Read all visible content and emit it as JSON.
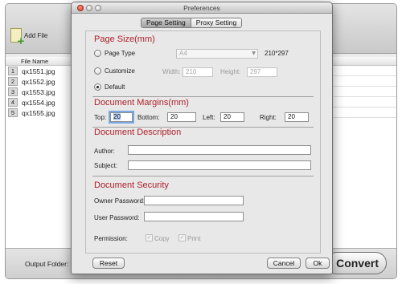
{
  "app": {
    "toolbar": {
      "add_file_label": "Add File"
    },
    "file_list": {
      "header": "File Name",
      "rows": [
        {
          "num": "1",
          "name": "qx1551.jpg"
        },
        {
          "num": "2",
          "name": "qx1552.jpg"
        },
        {
          "num": "3",
          "name": "qx1553.jpg"
        },
        {
          "num": "4",
          "name": "qx1554.jpg"
        },
        {
          "num": "5",
          "name": "qx1555.jpg"
        }
      ]
    },
    "bottom": {
      "output_folder_label": "Output Folder:",
      "convert_label": "Convert"
    }
  },
  "dialog": {
    "title": "Preferences",
    "tabs": [
      "Page Setting",
      "Proxy Setting"
    ],
    "active_tab": "Page Setting",
    "page_size": {
      "title": "Page Size(mm)",
      "page_type_label": "Page Type",
      "page_type_value": "A4",
      "page_type_dims": "210*297",
      "customize_label": "Customize",
      "width_label": "Width:",
      "width_value": "210",
      "height_label": "Height:",
      "height_value": "297",
      "default_label": "Default",
      "selected": "Default"
    },
    "margins": {
      "title": "Document Margins(mm)",
      "top_label": "Top:",
      "top_value": "20",
      "bottom_label": "Bottom:",
      "bottom_value": "20",
      "left_label": "Left:",
      "left_value": "20",
      "right_label": "Right:",
      "right_value": "20"
    },
    "description": {
      "title": "Document Description",
      "author_label": "Author:",
      "author_value": "",
      "subject_label": "Subject:",
      "subject_value": ""
    },
    "security": {
      "title": "Document Security",
      "owner_password_label": "Owner Password:",
      "owner_password_value": "",
      "user_password_label": "User Password:",
      "user_password_value": "",
      "permission_label": "Permission:",
      "copy_label": "Copy",
      "copy_checked": true,
      "print_label": "Print",
      "print_checked": true
    },
    "buttons": {
      "reset": "Reset",
      "cancel": "Cancel",
      "ok": "Ok"
    }
  }
}
